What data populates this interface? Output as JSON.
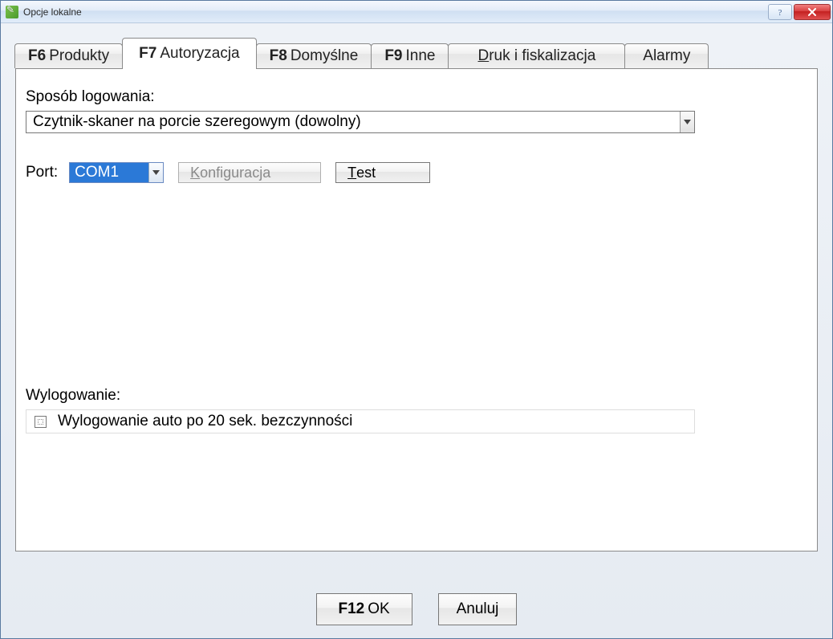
{
  "window": {
    "title": "Opcje lokalne"
  },
  "tabs": {
    "t0": {
      "key": "F6",
      "label": "Produkty"
    },
    "t1": {
      "key": "F7",
      "label": "Autoryzacja"
    },
    "t2": {
      "key": "F8",
      "label": "Domyślne"
    },
    "t3": {
      "key": "F9",
      "label": "Inne"
    },
    "t4": {
      "mn": "D",
      "rest": "ruk i fiskalizacja"
    },
    "t5": {
      "label": "Alarmy"
    }
  },
  "auth": {
    "loginMethodLabel": "Sposób logowania:",
    "loginMethodValue": "Czytnik-skaner na porcie szeregowym (dowolny)",
    "portLabel": "Port:",
    "portValue": "COM1",
    "konf": {
      "mn": "K",
      "rest": "onfiguracja"
    },
    "test": {
      "mn": "T",
      "rest": "est"
    },
    "logoutLabel": "Wylogowanie:",
    "logoutCheck": {
      "mn": "W",
      "rest": "ylogowanie auto po 20 sek. bezczynności"
    }
  },
  "buttons": {
    "ok": {
      "key": "F12",
      "label": "OK"
    },
    "cancel": "Anuluj"
  }
}
